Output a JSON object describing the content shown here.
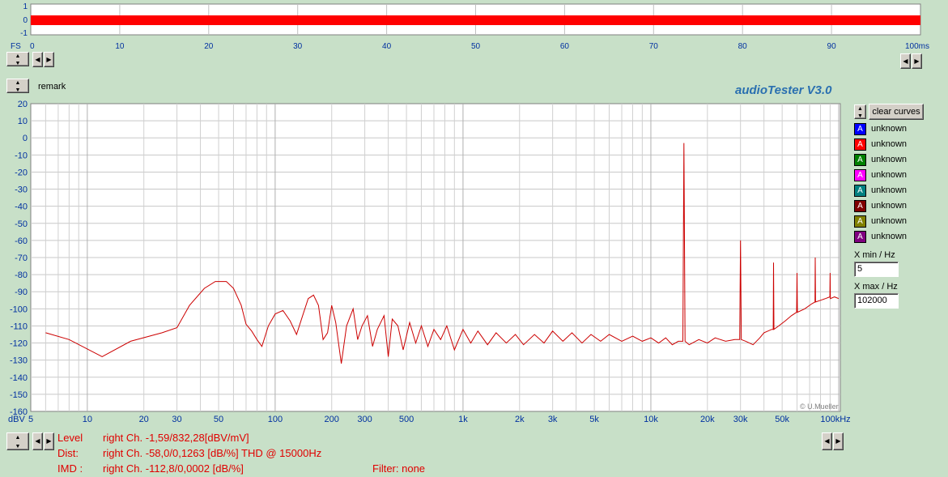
{
  "top_scope": {
    "y_ticks": [
      "1",
      "0",
      "-1"
    ],
    "x_ticks": [
      "0",
      "10",
      "20",
      "30",
      "40",
      "50",
      "60",
      "70",
      "80",
      "90",
      "100ms"
    ],
    "x_left_label": "FS",
    "trace_color": "#FF0000"
  },
  "remark_label": "remark",
  "app_title": "audioTester  V3.0",
  "clear_button_label": "clear curves",
  "legend": [
    {
      "label": "unknown",
      "letter": "A",
      "color": "#0000FF"
    },
    {
      "label": "unknown",
      "letter": "A",
      "color": "#FF0000"
    },
    {
      "label": "unknown",
      "letter": "A",
      "color": "#008000"
    },
    {
      "label": "unknown",
      "letter": "A",
      "color": "#FF00FF"
    },
    {
      "label": "unknown",
      "letter": "A",
      "color": "#008080"
    },
    {
      "label": "unknown",
      "letter": "A",
      "color": "#800000"
    },
    {
      "label": "unknown",
      "letter": "A",
      "color": "#808000"
    },
    {
      "label": "unknown",
      "letter": "A",
      "color": "#800080"
    }
  ],
  "x_min": {
    "label": "X min / Hz",
    "value": "5"
  },
  "x_max": {
    "label": "X max / Hz",
    "value": "102000"
  },
  "copyright": "© U.Mueller",
  "readouts": {
    "level_label": "Level",
    "level_value": "right Ch. -1,59/832,28[dBV/mV]",
    "dist_label": "Dist:",
    "dist_value": "right Ch. -58,0/0,1263 [dB/%] THD @ 15000Hz",
    "imd_label": "IMD :",
    "imd_value": "right Ch. -112,8/0,0002 [dB/%]",
    "filter": "Filter: none"
  },
  "chart_data": {
    "type": "line",
    "xscale": "log",
    "xlim": [
      5,
      102000
    ],
    "ylim": [
      -160,
      20
    ],
    "ylabel_unit": "dBV",
    "xunit": "kHz",
    "x_tick_labels": [
      {
        "v": 10,
        "t": "10"
      },
      {
        "v": 20,
        "t": "20"
      },
      {
        "v": 30,
        "t": "30"
      },
      {
        "v": 50,
        "t": "50"
      },
      {
        "v": 100,
        "t": "100"
      },
      {
        "v": 200,
        "t": "200"
      },
      {
        "v": 300,
        "t": "300"
      },
      {
        "v": 500,
        "t": "500"
      },
      {
        "v": 1000,
        "t": "1k"
      },
      {
        "v": 2000,
        "t": "2k"
      },
      {
        "v": 3000,
        "t": "3k"
      },
      {
        "v": 5000,
        "t": "5k"
      },
      {
        "v": 10000,
        "t": "10k"
      },
      {
        "v": 20000,
        "t": "20k"
      },
      {
        "v": 30000,
        "t": "30k"
      },
      {
        "v": 50000,
        "t": "50k"
      },
      {
        "v": 100000,
        "t": "100kHz"
      }
    ],
    "x_first_label": "5",
    "y_ticks": [
      20,
      10,
      0,
      -10,
      -20,
      -30,
      -40,
      -50,
      -60,
      -70,
      -80,
      -90,
      -100,
      -110,
      -120,
      -130,
      -140,
      -150,
      -160
    ],
    "grid": true,
    "series": [
      {
        "color": "#CC0000",
        "points": [
          [
            6,
            -114
          ],
          [
            8,
            -118
          ],
          [
            12,
            -128
          ],
          [
            17,
            -119
          ],
          [
            25,
            -114
          ],
          [
            30,
            -111
          ],
          [
            35,
            -98
          ],
          [
            42,
            -88
          ],
          [
            48,
            -84
          ],
          [
            55,
            -84
          ],
          [
            60,
            -88
          ],
          [
            66,
            -98
          ],
          [
            70,
            -109
          ],
          [
            75,
            -113
          ],
          [
            80,
            -118
          ],
          [
            85,
            -122
          ],
          [
            92,
            -110
          ],
          [
            100,
            -103
          ],
          [
            110,
            -101
          ],
          [
            120,
            -107
          ],
          [
            130,
            -115
          ],
          [
            140,
            -104
          ],
          [
            150,
            -94
          ],
          [
            160,
            -92
          ],
          [
            170,
            -98
          ],
          [
            180,
            -118
          ],
          [
            190,
            -114
          ],
          [
            200,
            -98
          ],
          [
            210,
            -108
          ],
          [
            225,
            -132
          ],
          [
            240,
            -110
          ],
          [
            260,
            -100
          ],
          [
            275,
            -118
          ],
          [
            290,
            -110
          ],
          [
            310,
            -104
          ],
          [
            330,
            -122
          ],
          [
            350,
            -112
          ],
          [
            380,
            -104
          ],
          [
            400,
            -128
          ],
          [
            420,
            -106
          ],
          [
            450,
            -110
          ],
          [
            480,
            -124
          ],
          [
            520,
            -108
          ],
          [
            560,
            -120
          ],
          [
            600,
            -110
          ],
          [
            650,
            -122
          ],
          [
            700,
            -112
          ],
          [
            760,
            -118
          ],
          [
            820,
            -110
          ],
          [
            900,
            -124
          ],
          [
            1000,
            -112
          ],
          [
            1100,
            -120
          ],
          [
            1200,
            -113
          ],
          [
            1350,
            -121
          ],
          [
            1500,
            -114
          ],
          [
            1700,
            -120
          ],
          [
            1900,
            -115
          ],
          [
            2100,
            -121
          ],
          [
            2400,
            -115
          ],
          [
            2700,
            -120
          ],
          [
            3000,
            -113
          ],
          [
            3400,
            -119
          ],
          [
            3800,
            -114
          ],
          [
            4300,
            -120
          ],
          [
            4800,
            -115
          ],
          [
            5400,
            -119
          ],
          [
            6000,
            -115
          ],
          [
            7000,
            -119
          ],
          [
            8000,
            -116
          ],
          [
            9000,
            -119
          ],
          [
            10000,
            -117
          ],
          [
            11000,
            -120
          ],
          [
            12000,
            -117
          ],
          [
            13000,
            -121
          ],
          [
            14000,
            -119
          ],
          [
            14800,
            -119
          ],
          [
            15000,
            -3
          ],
          [
            15200,
            -119
          ],
          [
            16000,
            -121
          ],
          [
            18000,
            -118
          ],
          [
            20000,
            -120
          ],
          [
            22000,
            -117
          ],
          [
            25000,
            -119
          ],
          [
            28000,
            -118
          ],
          [
            29700,
            -118
          ],
          [
            30000,
            -60
          ],
          [
            30300,
            -118
          ],
          [
            32000,
            -119
          ],
          [
            35000,
            -121
          ],
          [
            38000,
            -117
          ],
          [
            40000,
            -114
          ],
          [
            44000,
            -112
          ],
          [
            44800,
            -112
          ],
          [
            45000,
            -73
          ],
          [
            45200,
            -112
          ],
          [
            48000,
            -110
          ],
          [
            52000,
            -107
          ],
          [
            56000,
            -104
          ],
          [
            59700,
            -102
          ],
          [
            60000,
            -79
          ],
          [
            60300,
            -102
          ],
          [
            66000,
            -100
          ],
          [
            72000,
            -97
          ],
          [
            74800,
            -96
          ],
          [
            75000,
            -70
          ],
          [
            75300,
            -96
          ],
          [
            80000,
            -95
          ],
          [
            85000,
            -94
          ],
          [
            89700,
            -93
          ],
          [
            90000,
            -79
          ],
          [
            90300,
            -94
          ],
          [
            95000,
            -93
          ],
          [
            100000,
            -94
          ]
        ]
      }
    ]
  }
}
